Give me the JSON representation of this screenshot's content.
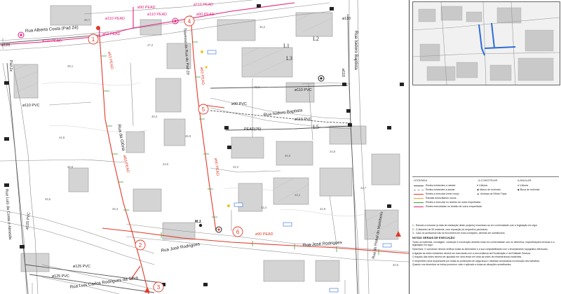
{
  "colors": {
    "water_main": "#e0207a",
    "new_network": "#e23a2a",
    "existing_network": "#555555",
    "green_marks": "#3aa537",
    "building": "#cfcfcf",
    "road_outline": "#8a8a8a",
    "keymap_water": "#2d6bd8"
  },
  "streets": {
    "alberto_costa": "Rua Alberto Costa (Pad Zé)",
    "pad_ze": "Pad Zé",
    "isidoro_baptista_h": "Rua Isidoro Baptista",
    "isidoro_baptista_v": "Rua Isidoro Baptista",
    "travessa": "Travessa da Rua do Pad Zé",
    "da_gloria": "Rua da Glória",
    "jose_rodrigues_left": "Rua José Rodrigues",
    "jose_rodrigues_right": "Rua José Rodrigues",
    "luis_da_costa": "Rua Luís da Costa e Almeida",
    "carlos_rodrigues": "Rua Luís Carlos Rodrigues da Silva",
    "pinhal": "Rua do Pinhal do Marinheiro"
  },
  "pipes": {
    "t1": "ø110 PEAD",
    "t2": "ø90 PEAD",
    "t3": "ø110 PEAD",
    "t4": "ø90 PEAD",
    "t5": "ø110 PEAD",
    "t6": "ø63 PEAD",
    "t7": "ø110 PEAD",
    "t8": "ø125",
    "t9": "ø110 PVC",
    "t10": "ø90 PVC",
    "t11": "ø110 PVC",
    "t12": "ø63 PEAD",
    "t13": "ø63 PEAD",
    "t14": "ø90 PEAD",
    "t15": "ø63 PEAD",
    "t16": "ø90 PEAD",
    "t17": "ø125 PVC",
    "t18": "ø125 PVC",
    "t19": "ø125 PVC",
    "t20": "ø110",
    "t21": "ø110",
    "t22": "PEAD(76)"
  },
  "nodes": [
    "1",
    "2",
    "3",
    "4",
    "5",
    "6"
  ],
  "lots": {
    "l1": "L1",
    "l2": "L2",
    "l3": "L3",
    "l5": "L5"
  },
  "elevations": [
    "48,1",
    "46,8",
    "45,8",
    "47,2",
    "46,0",
    "44,5",
    "45,9",
    "43,2",
    "42,1",
    "46,3",
    "44,8",
    "41,7",
    "45,3",
    "40,6",
    "44,9",
    "46,7",
    "43,4",
    "42,9",
    "45,0",
    "46,2"
  ],
  "markers": {
    "mj": "M.J."
  },
  "legend": {
    "head_main": "LEGENDA",
    "head_construir": "A CONSTRUIR",
    "head_anular": "A ANULAR",
    "rows": [
      "Redes existentes a manter",
      "Redes existentes a anular",
      "Redes a executar (rede nova)",
      "Ramais domiciliários novos",
      "Redes a executar no âmbito de outra empreitada",
      "Redes executadas no âmbito de outra empreitada"
    ],
    "sym_valvula": "Válvula",
    "sym_marco": "Marco de Incêndio",
    "sym_ventosa": "Ventosa de Efeito Triplo",
    "sym_valvula2": "Válvula",
    "sym_boca": "Boca de Incêndio"
  },
  "notes": {
    "n1": "1 - Ramais a executar (à data de realização deste projecto) encontram-se em conformidade com a legislação em vigor.",
    "n2": "2 - O diâmetro de 50 existente, com reposição do respectivo pavimento.",
    "n3": "3 - Caso os acessórios não se encontrem em boas condições, deverão ser substituídos.",
    "title": "NOTAS GERAIS DE EXECUÇÃO",
    "g1": "Todos os materiais, montagem, condução e construção deverão estar em conformidade com os desenhos, especificações técnicas e a legislação em vigor.",
    "g2": "Desenhos: O construtor deverá verificar todas as dimensões e a sua compatibilidade com o levantamento topográfico efectuado.",
    "g3": "A ligação às redes existentes deverá ser executada com a concordância da Fiscalização e da Entidade Gestora.",
    "g4": "O traçado das redes deverá ser ajustado em obra tendo em vista as redes de infraestruturas existentes.",
    "g5": "O empreiteiro será responsável por todas as protecções de segurança e medidas necessárias à execução dos trabalhos.",
    "g6": "Quando nos desenhos se indica pormenor, este é aplicado a todas as situações semelhantes."
  }
}
